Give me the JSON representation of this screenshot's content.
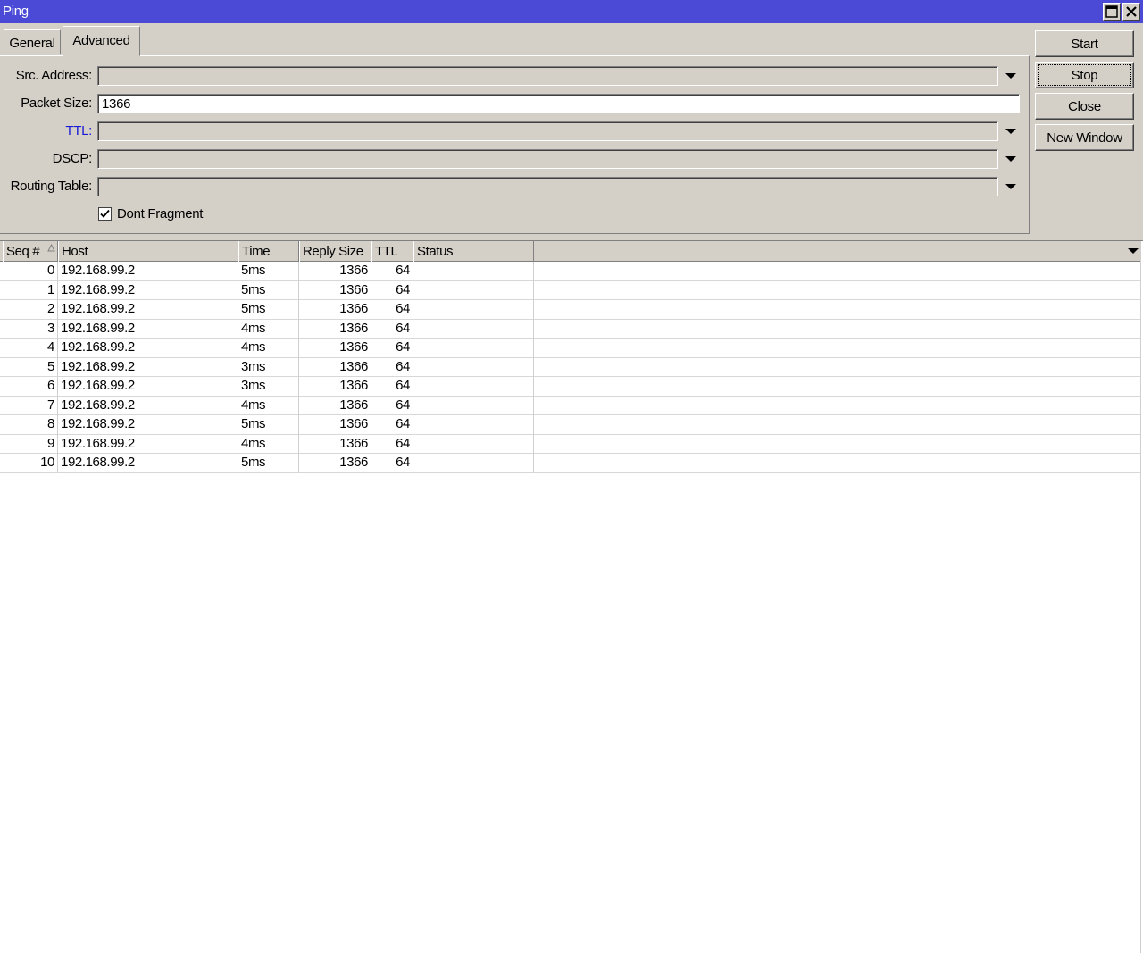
{
  "window": {
    "title": "Ping",
    "title_bar_color": "#4a4ad6"
  },
  "tabs": [
    {
      "label": "General",
      "active": false
    },
    {
      "label": "Advanced",
      "active": true
    }
  ],
  "form": {
    "src_address": {
      "label": "Src. Address:",
      "value": ""
    },
    "packet_size": {
      "label": "Packet Size:",
      "value": "1366"
    },
    "ttl": {
      "label": "TTL:",
      "value": "",
      "label_color": "#1a1ad6"
    },
    "dscp": {
      "label": "DSCP:",
      "value": ""
    },
    "routing_table": {
      "label": "Routing Table:",
      "value": ""
    },
    "dont_fragment": {
      "label": "Dont Fragment",
      "checked": true
    }
  },
  "buttons": {
    "start": "Start",
    "stop": "Stop",
    "close": "Close",
    "new_window": "New Window"
  },
  "table": {
    "columns": [
      "Seq #",
      "Host",
      "Time",
      "Reply Size",
      "TTL",
      "Status"
    ],
    "sort_column": "Seq #",
    "rows": [
      {
        "seq": "0",
        "host": "192.168.99.2",
        "time": "5ms",
        "reply_size": "1366",
        "ttl": "64",
        "status": ""
      },
      {
        "seq": "1",
        "host": "192.168.99.2",
        "time": "5ms",
        "reply_size": "1366",
        "ttl": "64",
        "status": ""
      },
      {
        "seq": "2",
        "host": "192.168.99.2",
        "time": "5ms",
        "reply_size": "1366",
        "ttl": "64",
        "status": ""
      },
      {
        "seq": "3",
        "host": "192.168.99.2",
        "time": "4ms",
        "reply_size": "1366",
        "ttl": "64",
        "status": ""
      },
      {
        "seq": "4",
        "host": "192.168.99.2",
        "time": "4ms",
        "reply_size": "1366",
        "ttl": "64",
        "status": ""
      },
      {
        "seq": "5",
        "host": "192.168.99.2",
        "time": "3ms",
        "reply_size": "1366",
        "ttl": "64",
        "status": ""
      },
      {
        "seq": "6",
        "host": "192.168.99.2",
        "time": "3ms",
        "reply_size": "1366",
        "ttl": "64",
        "status": ""
      },
      {
        "seq": "7",
        "host": "192.168.99.2",
        "time": "4ms",
        "reply_size": "1366",
        "ttl": "64",
        "status": ""
      },
      {
        "seq": "8",
        "host": "192.168.99.2",
        "time": "5ms",
        "reply_size": "1366",
        "ttl": "64",
        "status": ""
      },
      {
        "seq": "9",
        "host": "192.168.99.2",
        "time": "4ms",
        "reply_size": "1366",
        "ttl": "64",
        "status": ""
      },
      {
        "seq": "10",
        "host": "192.168.99.2",
        "time": "5ms",
        "reply_size": "1366",
        "ttl": "64",
        "status": ""
      }
    ]
  }
}
